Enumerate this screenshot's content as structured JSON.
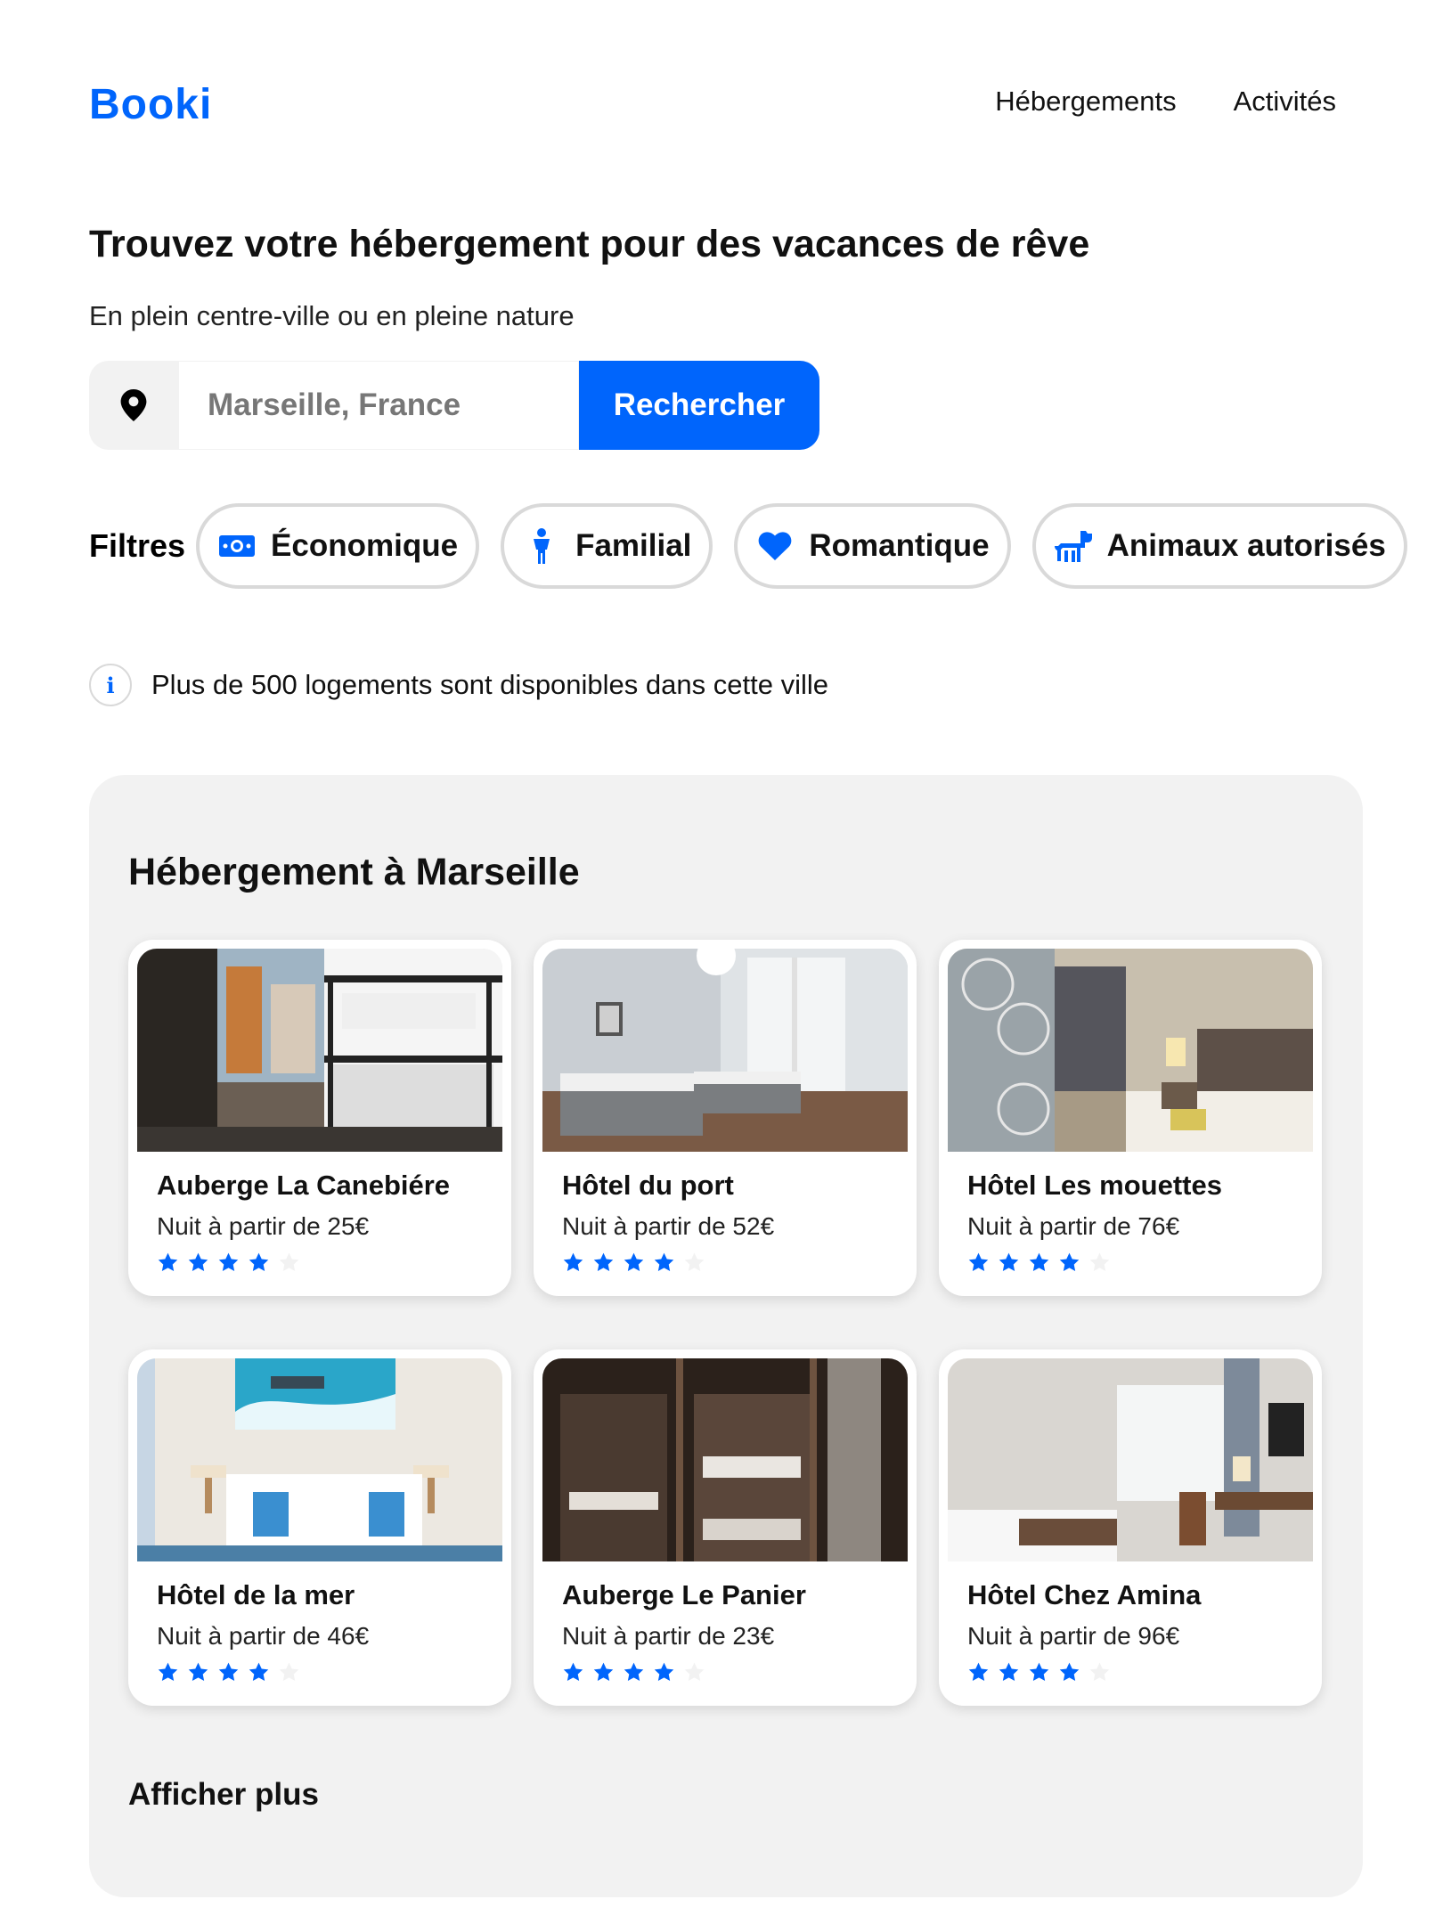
{
  "brand": {
    "logo": "Booki",
    "accent": "#0065FC"
  },
  "nav": {
    "items": [
      "Hébergements",
      "Activités"
    ]
  },
  "hero": {
    "title": "Trouvez votre hébergement pour des vacances de rêve",
    "subtitle": "En plein centre-ville ou en pleine nature"
  },
  "search": {
    "placeholder": "Marseille, France",
    "button": "Rechercher",
    "icon": "location-pin-icon"
  },
  "filters": {
    "label": "Filtres",
    "items": [
      {
        "label": "Économique",
        "icon": "money-icon"
      },
      {
        "label": "Familial",
        "icon": "child-icon"
      },
      {
        "label": "Romantique",
        "icon": "heart-icon"
      },
      {
        "label": "Animaux autorisés",
        "icon": "dog-icon"
      }
    ]
  },
  "info": {
    "text": "Plus de 500 logements sont disponibles dans cette ville",
    "icon": "info-icon"
  },
  "listing": {
    "title": "Hébergement à Marseille",
    "cards": [
      {
        "name": "Auberge La Canebiére",
        "price": "Nuit à partir de 25€",
        "rating": 4,
        "max_rating": 5
      },
      {
        "name": "Hôtel du port",
        "price": "Nuit à partir de 52€",
        "rating": 4,
        "max_rating": 5
      },
      {
        "name": "Hôtel Les mouettes",
        "price": "Nuit à partir de 76€",
        "rating": 4,
        "max_rating": 5
      },
      {
        "name": "Hôtel de la mer",
        "price": "Nuit à partir de 46€",
        "rating": 4,
        "max_rating": 5
      },
      {
        "name": "Auberge Le Panier",
        "price": "Nuit à partir de 23€",
        "rating": 4,
        "max_rating": 5
      },
      {
        "name": "Hôtel Chez Amina",
        "price": "Nuit à partir de 96€",
        "rating": 4,
        "max_rating": 5
      }
    ],
    "more": "Afficher plus"
  }
}
